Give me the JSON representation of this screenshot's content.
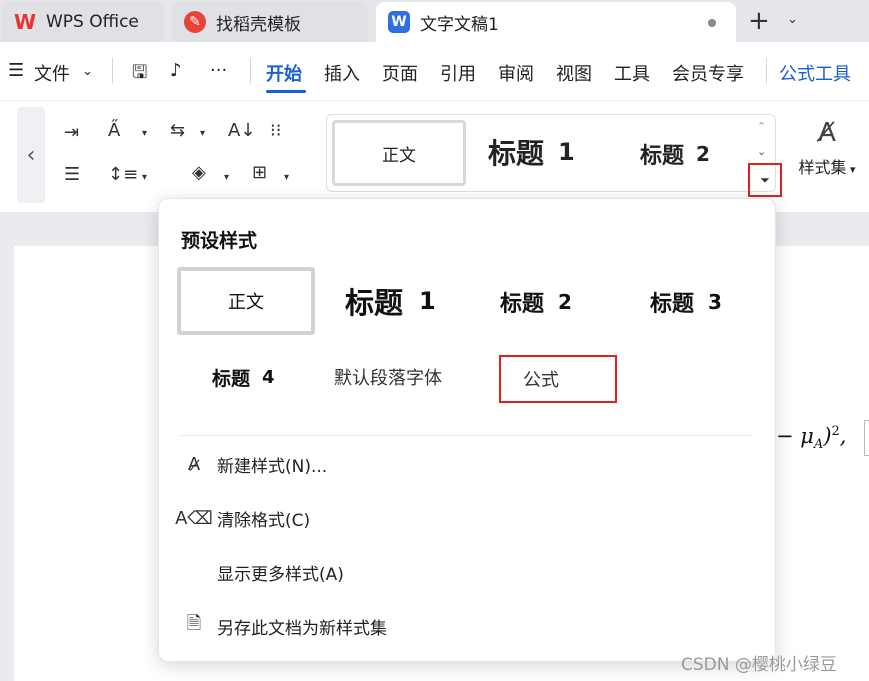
{
  "tabs": [
    {
      "label": "WPS Office",
      "icon": "wps-logo-icon"
    },
    {
      "label": "找稻壳模板",
      "icon": "daoke-logo-icon"
    },
    {
      "label": "文字文稿1",
      "icon": "writer-doc-icon",
      "active": true,
      "unsaved": true
    }
  ],
  "menubar": {
    "file_label": "文件",
    "items": [
      "开始",
      "插入",
      "页面",
      "引用",
      "审阅",
      "视图",
      "工具",
      "会员专享"
    ],
    "active": "开始",
    "contextual": "公式工具"
  },
  "ribbon": {
    "gallery": {
      "normal": "正文",
      "h1": "标题",
      "h1_num": "1",
      "h2": "标题",
      "h2_num": "2"
    },
    "styleset_label": "样式集"
  },
  "document": {
    "formula_visible": "− μA)2,"
  },
  "style_panel": {
    "title": "预设样式",
    "styles": {
      "normal": "正文",
      "h1": "标题",
      "h1_num": "1",
      "h2": "标题",
      "h2_num": "2",
      "h3": "标题",
      "h3_num": "3",
      "h4": "标题",
      "h4_num": "4",
      "default_font": "默认段落字体",
      "formula": "公式"
    },
    "actions": [
      "新建样式(N)...",
      "清除格式(C)",
      "显示更多样式(A)",
      "另存此文档为新样式集"
    ]
  },
  "watermark": "CSDN @樱桃小绿豆",
  "colors": {
    "accent": "#1a5fd6",
    "highlight_box": "#e02020"
  }
}
